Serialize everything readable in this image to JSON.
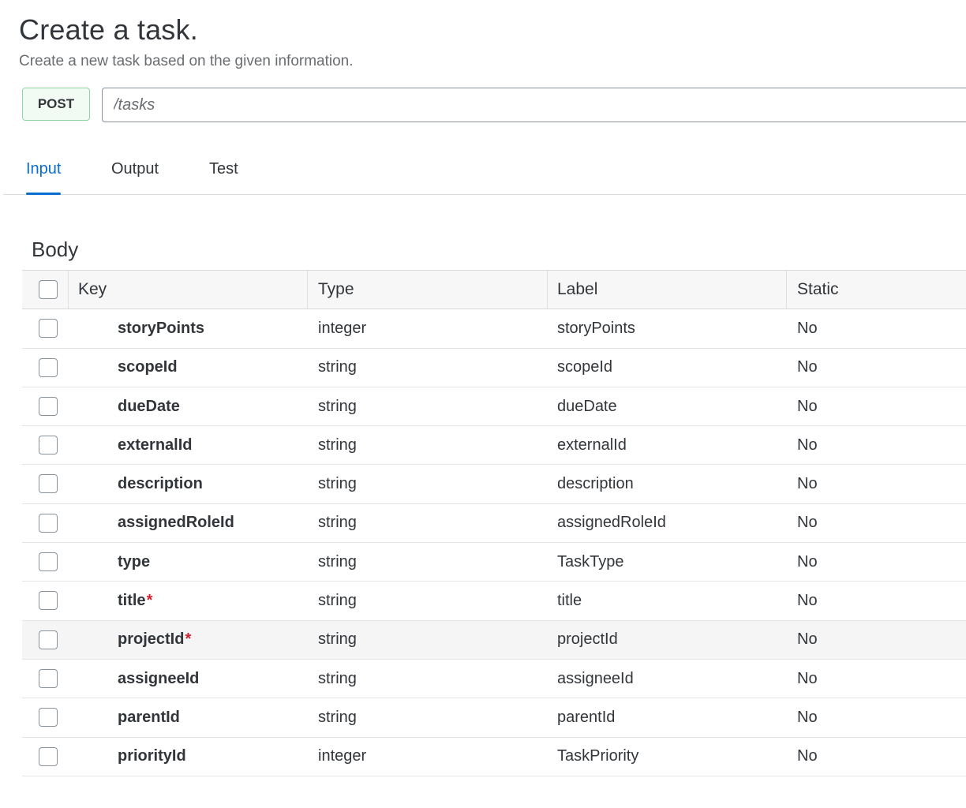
{
  "header": {
    "title": "Create a task.",
    "subtitle": "Create a new task based on the given information."
  },
  "endpoint": {
    "method": "POST",
    "path": "/tasks",
    "method_border_color": "#8fd4a5",
    "method_background_color": "#f1fbf4"
  },
  "tabs": [
    {
      "label": "Input",
      "active": true
    },
    {
      "label": "Output",
      "active": false
    },
    {
      "label": "Test",
      "active": false
    }
  ],
  "accent_color": "#0a6ed1",
  "required_color": "#d32030",
  "body": {
    "section_title": "Body",
    "columns": {
      "key": "Key",
      "type": "Type",
      "label": "Label",
      "static": "Static"
    },
    "rows": [
      {
        "key": "storyPoints",
        "required": "",
        "type": "integer",
        "label": "storyPoints",
        "static": "No"
      },
      {
        "key": "scopeId",
        "required": "",
        "type": "string",
        "label": "scopeId",
        "static": "No"
      },
      {
        "key": "dueDate",
        "required": "",
        "type": "string",
        "label": "dueDate",
        "static": "No"
      },
      {
        "key": "externalId",
        "required": "",
        "type": "string",
        "label": "externalId",
        "static": "No"
      },
      {
        "key": "description",
        "required": "",
        "type": "string",
        "label": "description",
        "static": "No"
      },
      {
        "key": "assignedRoleId",
        "required": "",
        "type": "string",
        "label": "assignedRoleId",
        "static": "No"
      },
      {
        "key": "type",
        "required": "",
        "type": "string",
        "label": "TaskType",
        "static": "No"
      },
      {
        "key": "title",
        "required": "*",
        "type": "string",
        "label": "title",
        "static": "No"
      },
      {
        "key": "projectId",
        "required": "*",
        "type": "string",
        "label": "projectId",
        "static": "No"
      },
      {
        "key": "assigneeId",
        "required": "",
        "type": "string",
        "label": "assigneeId",
        "static": "No"
      },
      {
        "key": "parentId",
        "required": "",
        "type": "string",
        "label": "parentId",
        "static": "No"
      },
      {
        "key": "priorityId",
        "required": "",
        "type": "integer",
        "label": "TaskPriority",
        "static": "No"
      }
    ]
  }
}
